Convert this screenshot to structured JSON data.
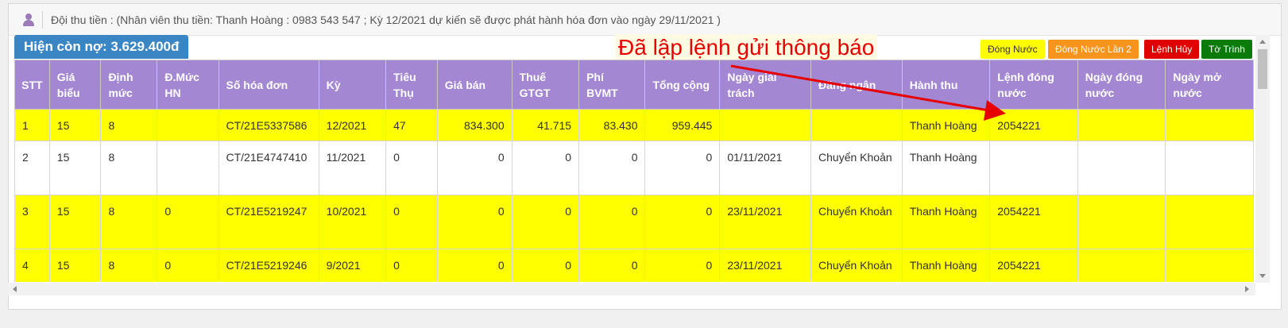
{
  "header": {
    "text": "Đội thu tiền : (Nhân viên thu tiền: Thanh Hoàng : 0983 543 547 ; Kỳ 12/2021 dự kiến sẽ được phát hành hóa đơn vào ngày 29/11/2021 )"
  },
  "debt": {
    "label": "Hiện còn nợ: 3.629.400đ"
  },
  "annotation": "Đã lập lệnh gửi thông báo",
  "buttons": {
    "water": "Đóng Nước",
    "water2": "Đóng Nước Lần 2",
    "cancel": "Lệnh Hủy",
    "report": "Tờ Trình"
  },
  "columns": [
    "STT",
    "Giá biểu",
    "Định mức",
    "Đ.Mức HN",
    "Số hóa đơn",
    "Kỳ",
    "Tiêu Thụ",
    "Giá bán",
    "Thuế GTGT",
    "Phí BVMT",
    "Tổng cộng",
    "Ngày giải trách",
    "Đăng ngân",
    "Hành thu",
    "Lệnh đóng nước",
    "Ngày đóng nước",
    "Ngày mở nước"
  ],
  "rows": [
    [
      "1",
      "15",
      "8",
      "",
      "CT/21E5337586",
      "12/2021",
      "47",
      "834.300",
      "41.715",
      "83.430",
      "959.445",
      "",
      "",
      "Thanh Hoàng",
      "2054221",
      "",
      ""
    ],
    [
      "2",
      "15",
      "8",
      "",
      "CT/21E4747410",
      "11/2021",
      "0",
      "0",
      "0",
      "0",
      "0",
      "01/11/2021",
      "Chuyển Khoản",
      "Thanh Hoàng",
      "",
      "",
      ""
    ],
    [
      "3",
      "15",
      "8",
      "0",
      "CT/21E5219247",
      "10/2021",
      "0",
      "0",
      "0",
      "0",
      "0",
      "23/11/2021",
      "Chuyển Khoản",
      "Thanh Hoàng",
      "2054221",
      "",
      ""
    ],
    [
      "4",
      "15",
      "8",
      "0",
      "CT/21E5219246",
      "9/2021",
      "0",
      "0",
      "0",
      "0",
      "0",
      "23/11/2021",
      "Chuyển Khoản",
      "Thanh Hoàng",
      "2054221",
      "",
      ""
    ]
  ],
  "colors": {
    "header_bg": "#a487d3",
    "highlight_row": "#ffff00",
    "badge": "#3a86c4",
    "annotation_text": "#e60000"
  }
}
